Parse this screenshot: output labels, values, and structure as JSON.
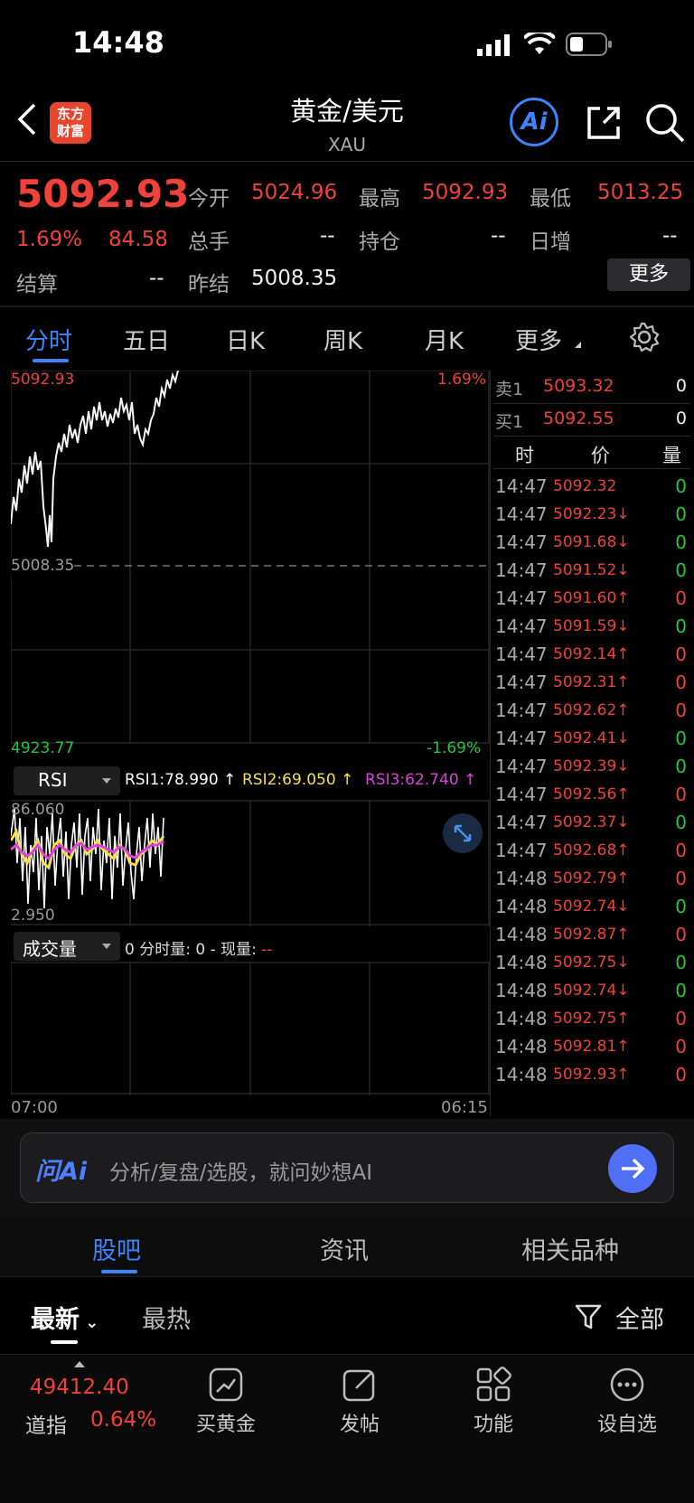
{
  "status_bar": {
    "time": "14:48"
  },
  "header": {
    "title": "黄金/美元",
    "subtitle": "XAU",
    "logo_line1": "东方",
    "logo_line2": "财富",
    "ai_label": "Ai"
  },
  "quote": {
    "price": "5092.93",
    "change_pct": "1.69%",
    "change": "84.58",
    "open_label": "今开",
    "open": "5024.96",
    "high_label": "最高",
    "high": "5092.93",
    "low_label": "最低",
    "low": "5013.25",
    "vol_label": "总手",
    "vol": "--",
    "oi_label": "持仓",
    "oi": "--",
    "daily_inc_label": "日增",
    "daily_inc": "--",
    "settle_label": "结算",
    "settle": "--",
    "prev_settle_label": "昨结",
    "prev_settle": "5008.35",
    "more_label": "更多"
  },
  "chart_tabs": [
    "分时",
    "五日",
    "日K",
    "周K",
    "月K",
    "更多"
  ],
  "chart": {
    "price_top": "5092.93",
    "pct_top": "1.69%",
    "price_mid": "5008.35",
    "price_bottom": "4923.77",
    "pct_bottom": "-1.69%",
    "rsi_selector": "RSI",
    "rsi1": "RSI1:78.990 ↑",
    "rsi2": "RSI2:69.050 ↑",
    "rsi3": "RSI3:62.740 ↑",
    "rsi_top": "86.060",
    "rsi_bottom": "2.950",
    "vol_selector": "成交量",
    "vol_text": "0 分时量: 0 - 现量: ",
    "vol_now": "--",
    "time_start": "07:00",
    "time_end": "06:15"
  },
  "order_book": {
    "sell1_label": "卖1",
    "sell1_price": "5093.32",
    "sell1_vol": "0",
    "buy1_label": "买1",
    "buy1_price": "5092.55",
    "buy1_vol": "0",
    "col_time": "时",
    "col_price": "价",
    "col_vol": "量"
  },
  "ticks": [
    {
      "t": "14:47",
      "p": "5092.32",
      "dir": "",
      "v": "0",
      "c": "green"
    },
    {
      "t": "14:47",
      "p": "5092.23↓",
      "dir": "down",
      "v": "0",
      "c": "green"
    },
    {
      "t": "14:47",
      "p": "5091.68↓",
      "dir": "down",
      "v": "0",
      "c": "green"
    },
    {
      "t": "14:47",
      "p": "5091.52↓",
      "dir": "down",
      "v": "0",
      "c": "green"
    },
    {
      "t": "14:47",
      "p": "5091.60↑",
      "dir": "up",
      "v": "0",
      "c": "red"
    },
    {
      "t": "14:47",
      "p": "5091.59↓",
      "dir": "down",
      "v": "0",
      "c": "green"
    },
    {
      "t": "14:47",
      "p": "5092.14↑",
      "dir": "up",
      "v": "0",
      "c": "red"
    },
    {
      "t": "14:47",
      "p": "5092.31↑",
      "dir": "up",
      "v": "0",
      "c": "red"
    },
    {
      "t": "14:47",
      "p": "5092.62↑",
      "dir": "up",
      "v": "0",
      "c": "red"
    },
    {
      "t": "14:47",
      "p": "5092.41↓",
      "dir": "down",
      "v": "0",
      "c": "green"
    },
    {
      "t": "14:47",
      "p": "5092.39↓",
      "dir": "down",
      "v": "0",
      "c": "green"
    },
    {
      "t": "14:47",
      "p": "5092.56↑",
      "dir": "up",
      "v": "0",
      "c": "red"
    },
    {
      "t": "14:47",
      "p": "5092.37↓",
      "dir": "down",
      "v": "0",
      "c": "green"
    },
    {
      "t": "14:47",
      "p": "5092.68↑",
      "dir": "up",
      "v": "0",
      "c": "red"
    },
    {
      "t": "14:48",
      "p": "5092.79↑",
      "dir": "up",
      "v": "0",
      "c": "red"
    },
    {
      "t": "14:48",
      "p": "5092.74↓",
      "dir": "down",
      "v": "0",
      "c": "green"
    },
    {
      "t": "14:48",
      "p": "5092.87↑",
      "dir": "up",
      "v": "0",
      "c": "red"
    },
    {
      "t": "14:48",
      "p": "5092.75↓",
      "dir": "down",
      "v": "0",
      "c": "green"
    },
    {
      "t": "14:48",
      "p": "5092.74↓",
      "dir": "down",
      "v": "0",
      "c": "green"
    },
    {
      "t": "14:48",
      "p": "5092.75↑",
      "dir": "up",
      "v": "0",
      "c": "red"
    },
    {
      "t": "14:48",
      "p": "5092.81↑",
      "dir": "up",
      "v": "0",
      "c": "red"
    },
    {
      "t": "14:48",
      "p": "5092.93↑",
      "dir": "up",
      "v": "0",
      "c": "red"
    }
  ],
  "ai_bar": {
    "logo": "问Ai",
    "placeholder": "分析/复盘/选股，就问妙想AI"
  },
  "lower_tabs": [
    "股吧",
    "资讯",
    "相关品种"
  ],
  "feed_filters": {
    "latest": "最新",
    "hot": "最热",
    "all": "全部"
  },
  "bottom_bar": {
    "index_value": "49412.40",
    "index_name": "道指",
    "index_pct": "0.64%",
    "buy_gold": "买黄金",
    "post": "发帖",
    "functions": "功能",
    "watchlist": "设自选"
  },
  "colors": {
    "up": "#f0413a",
    "down": "#1ec840",
    "accent": "#3a86ff",
    "rsi1": "#ffffff",
    "rsi2": "#f2e14a",
    "rsi3": "#e23fe0"
  }
}
